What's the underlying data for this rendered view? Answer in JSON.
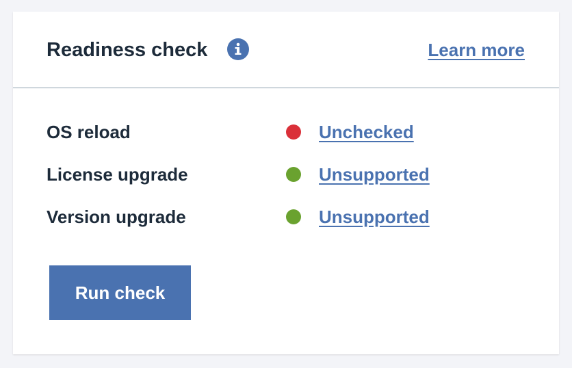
{
  "header": {
    "title": "Readiness check",
    "info_icon": "info-icon",
    "learn_more": "Learn more"
  },
  "checks": [
    {
      "label": "OS reload",
      "status": "Unchecked",
      "status_color": "#da3039"
    },
    {
      "label": "License upgrade",
      "status": "Unsupported",
      "status_color": "#6aa22f"
    },
    {
      "label": "Version upgrade",
      "status": "Unsupported",
      "status_color": "#6aa22f"
    }
  ],
  "actions": {
    "run_check": "Run check"
  },
  "colors": {
    "accent": "#4a72b0",
    "text": "#1d2b3a",
    "divider": "#8ea0ae",
    "background": "#f3f4f8"
  }
}
